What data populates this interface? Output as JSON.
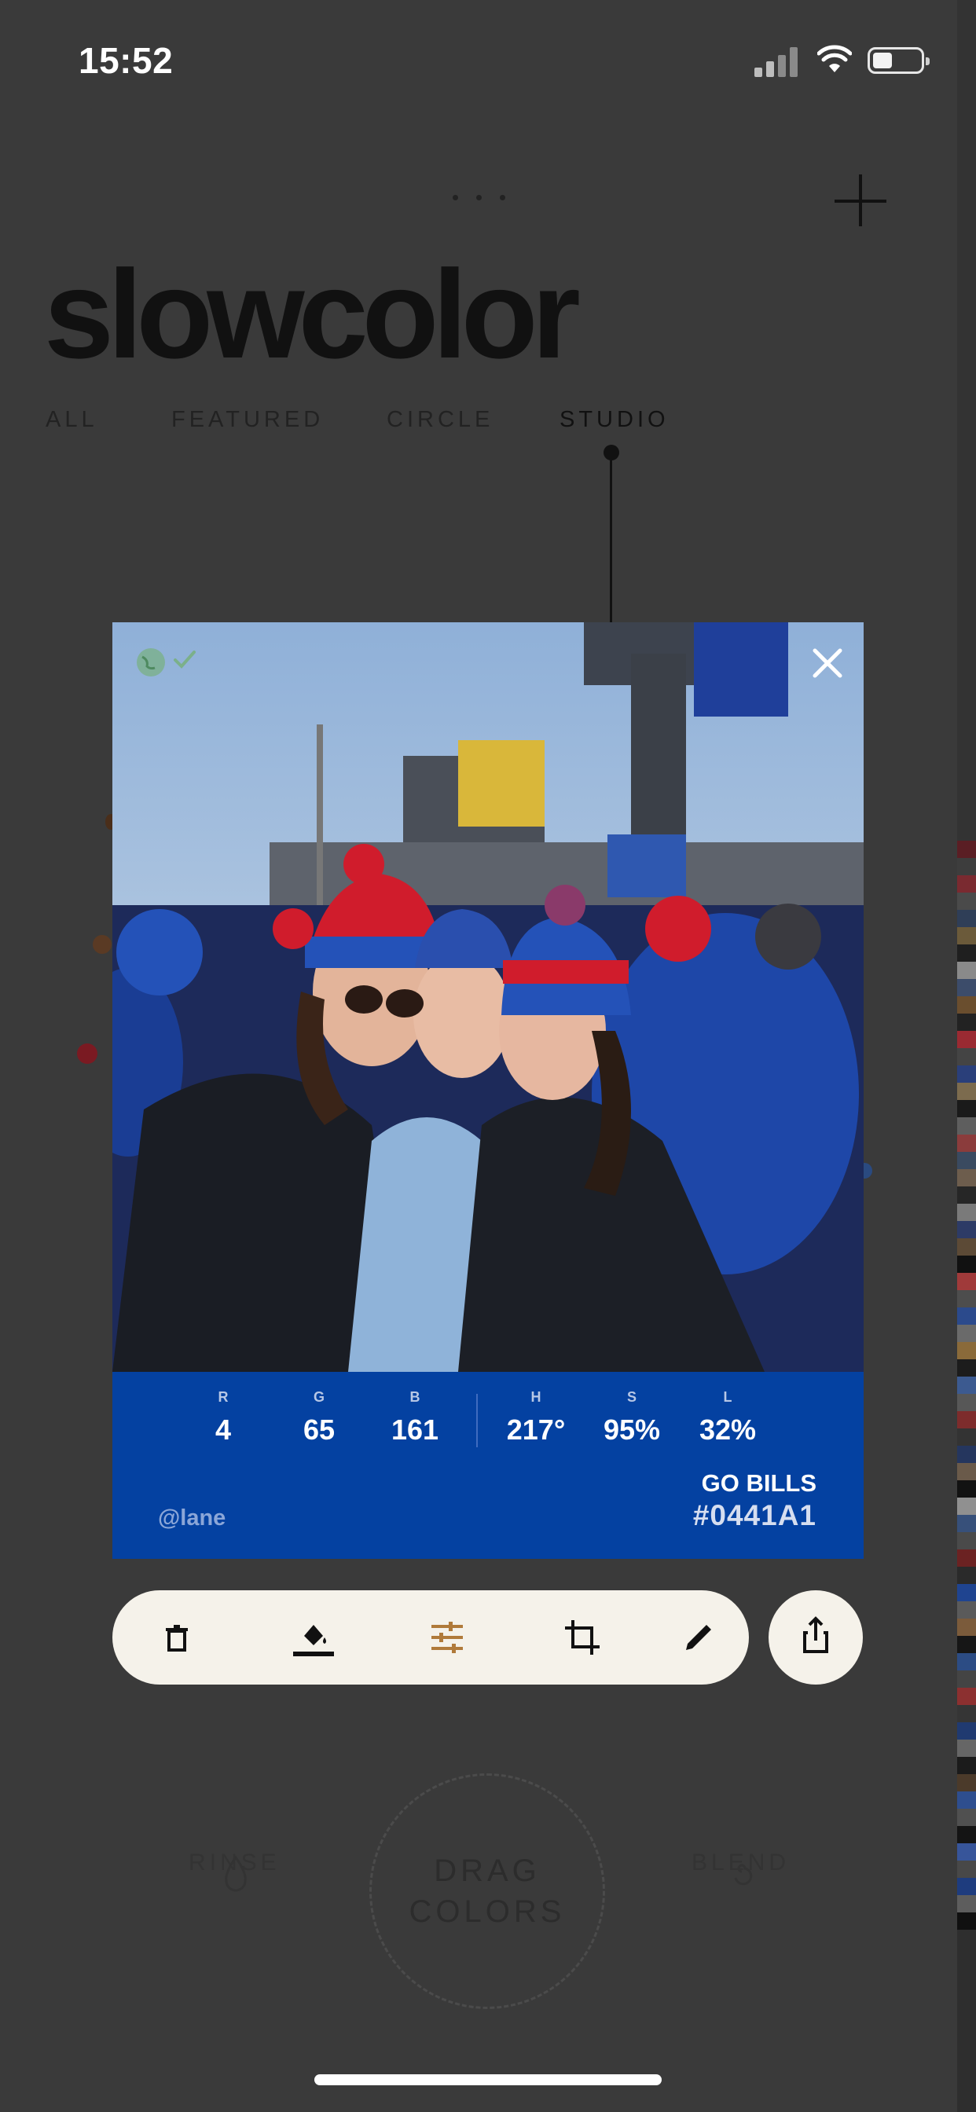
{
  "status_bar": {
    "time": "15:52"
  },
  "app": {
    "logo": "slowcolor",
    "tabs": [
      {
        "label": "ALL"
      },
      {
        "label": "FEATURED"
      },
      {
        "label": "CIRCLE"
      },
      {
        "label": "STUDIO"
      }
    ],
    "active_tab": "STUDIO"
  },
  "color_card": {
    "rgb": {
      "r_label": "R",
      "r": "4",
      "g_label": "G",
      "g": "65",
      "b_label": "B",
      "b": "161"
    },
    "hsl": {
      "h_label": "H",
      "h": "217°",
      "s_label": "S",
      "s": "95%",
      "l_label": "L",
      "l": "32%"
    },
    "user": "@lane",
    "color_name": "GO BILLS",
    "hex": "#0441A1",
    "swatch_color": "#0441a1"
  },
  "toolbar": {
    "icons": [
      "trash-icon",
      "paint-bucket-icon",
      "sliders-icon",
      "crop-icon",
      "pencil-icon"
    ],
    "share_icon": "share-icon"
  },
  "bottom": {
    "rinse_label": "RINSE",
    "blend_label": "BLEND",
    "drag_line1": "DRAG",
    "drag_line2": "COLORS"
  }
}
